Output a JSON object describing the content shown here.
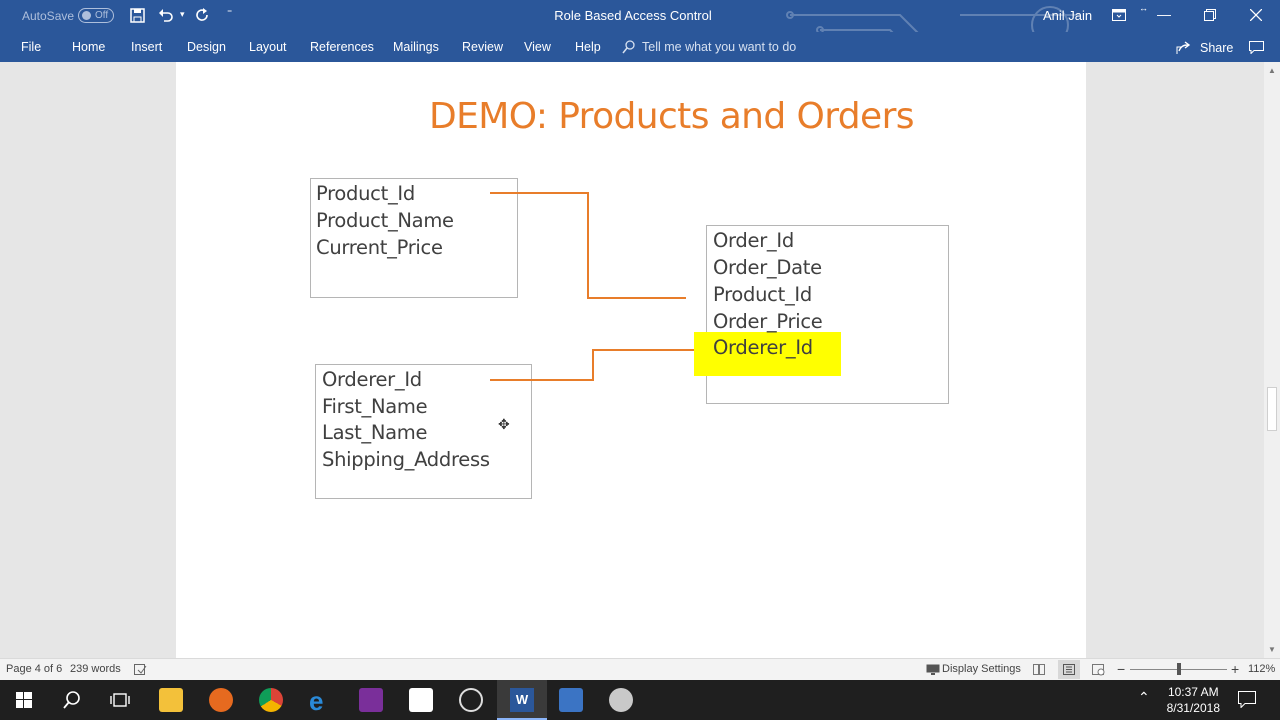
{
  "titlebar": {
    "autosave_label": "AutoSave",
    "autosave_state": "Off",
    "document_title": "Role Based Access Control",
    "user_name": "Anil Jain"
  },
  "ribbon": {
    "tabs": [
      "File",
      "Home",
      "Insert",
      "Design",
      "Layout",
      "References",
      "Mailings",
      "Review",
      "View",
      "Help"
    ],
    "search_placeholder": "Tell me what you want to do",
    "share_label": "Share"
  },
  "document": {
    "title": "DEMO:  Products and Orders",
    "products_fields": [
      "Product_Id",
      "Product_Name",
      "Current_Price"
    ],
    "orders_fields": [
      "Order_Id",
      "Order_Date",
      "Product_Id",
      "Order_Price",
      "Orderer_Id"
    ],
    "orderers_fields": [
      "Orderer_Id",
      "First_Name",
      "Last_Name",
      "Shipping_Address"
    ],
    "highlight_color": "#ffff00",
    "connector_color": "#e87d2a"
  },
  "status": {
    "page_info": "Page 4 of 6",
    "word_count": "239 words",
    "display_settings": "Display Settings",
    "zoom": "112%"
  },
  "taskbar": {
    "time": "10:37 AM",
    "date": "8/31/2018"
  }
}
